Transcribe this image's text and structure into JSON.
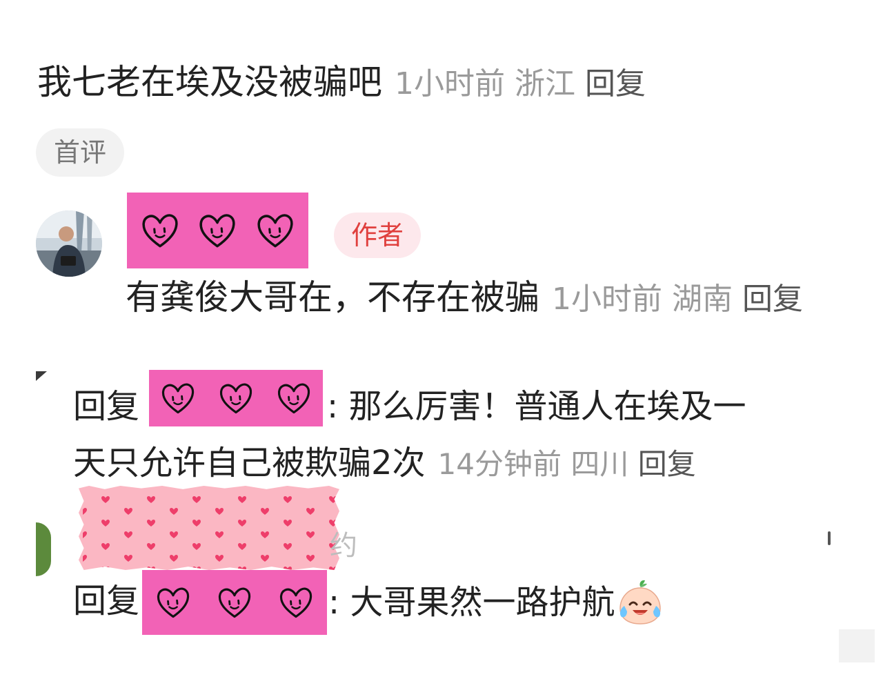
{
  "comment": {
    "text": "我七老在埃及没被骗吧",
    "time": "1小时前",
    "location": "浙江",
    "reply_label": "回复",
    "badge": "首评"
  },
  "author_reply": {
    "badge": "作者",
    "text": "有龚俊大哥在，不存在被骗",
    "time": "1小时前",
    "location": "湖南",
    "reply_label": "回复"
  },
  "reply1": {
    "prefix": "回复",
    "colon": ":",
    "text_line1": "那么厉害！普通人在埃及一",
    "text_line2": "天只允许自己被欺骗2次",
    "time": "14分钟前",
    "location": "四川",
    "reply_label": "回复"
  },
  "reply2": {
    "prefix": "回复",
    "colon": ":",
    "text": "大哥果然一路护航",
    "partial_name_char": "约"
  },
  "icons": {
    "sticker": "heart-face-sticker",
    "tape": "pink-heart-washi-tape",
    "emoji": "crying-laughing-peach-emoji"
  },
  "colors": {
    "sticker_pink": "#f262b6",
    "tape_pink": "#fbb7c3",
    "author_red": "#e0403e",
    "meta_gray": "#9a9a9a"
  }
}
